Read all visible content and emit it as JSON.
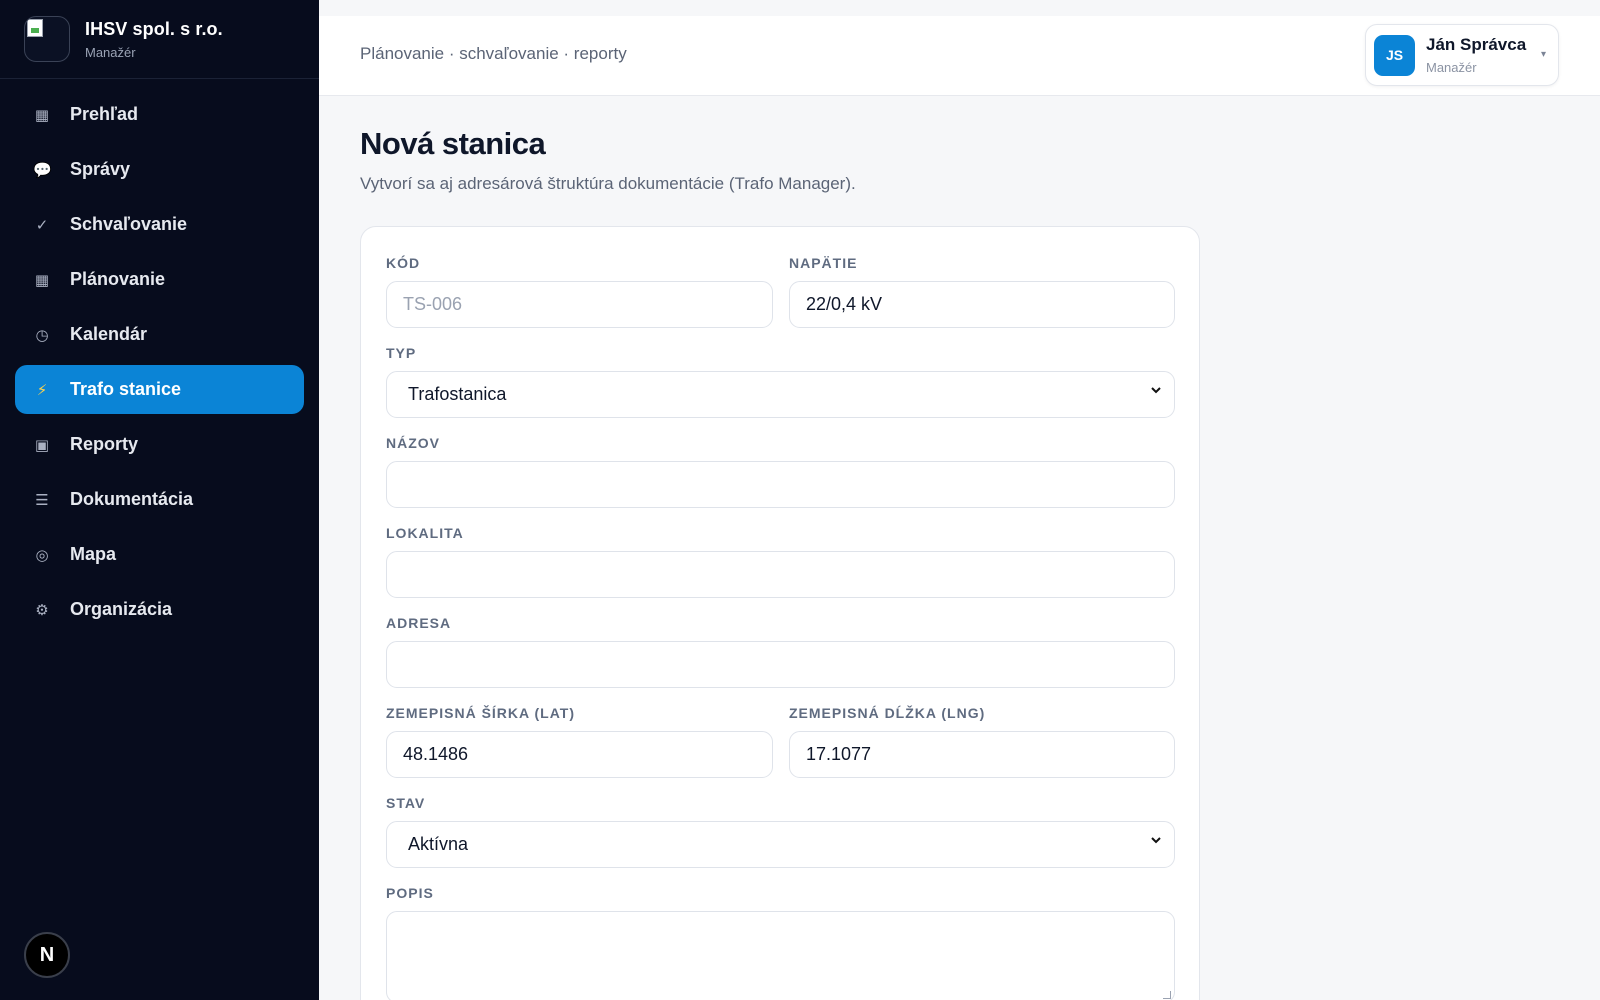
{
  "brand": {
    "name": "IHSV spol. s r.o.",
    "role": "Manažér"
  },
  "nav": {
    "items": [
      {
        "icon": "▦",
        "label": "Prehľad"
      },
      {
        "icon": "💬",
        "label": "Správy"
      },
      {
        "icon": "✓",
        "label": "Schvaľovanie"
      },
      {
        "icon": "▦",
        "label": "Plánovanie"
      },
      {
        "icon": "◷",
        "label": "Kalendár"
      },
      {
        "icon": "⚡",
        "label": "Trafo stanice"
      },
      {
        "icon": "▣",
        "label": "Reporty"
      },
      {
        "icon": "☰",
        "label": "Dokumentácia"
      },
      {
        "icon": "◎",
        "label": "Mapa"
      },
      {
        "icon": "⚙",
        "label": "Organizácia"
      }
    ],
    "active": "Trafo stanice"
  },
  "footer_badge": "N",
  "header": {
    "breadcrumb": "Plánovanie · schvaľovanie · reporty"
  },
  "user": {
    "initials": "JS",
    "name": "Ján Správca",
    "role": "Manažér",
    "caret": "▾"
  },
  "page": {
    "title": "Nová stanica",
    "subtitle": "Vytvorí sa aj adresárová štruktúra dokumentácie (Trafo Manager)."
  },
  "form": {
    "kod": {
      "label": "KÓD",
      "value": "",
      "placeholder": "TS-006"
    },
    "napatie": {
      "label": "NAPÄTIE",
      "value": "22/0,4 kV"
    },
    "typ": {
      "label": "TYP",
      "value": "Trafostanica"
    },
    "nazov": {
      "label": "NÁZOV",
      "value": ""
    },
    "lokalita": {
      "label": "LOKALITA",
      "value": ""
    },
    "adresa": {
      "label": "ADRESA",
      "value": ""
    },
    "lat": {
      "label": "ZEMEPISNÁ ŠÍRKA (LAT)",
      "value": "48.1486"
    },
    "lng": {
      "label": "ZEMEPISNÁ DĹŽKA (LNG)",
      "value": "17.1077"
    },
    "stav": {
      "label": "STAV",
      "value": "Aktívna"
    },
    "popis": {
      "label": "POPIS",
      "value": ""
    }
  },
  "colors": {
    "sidebar": "#070c1d",
    "accent": "#0b84d6",
    "active_icon": "#ffd34d"
  }
}
